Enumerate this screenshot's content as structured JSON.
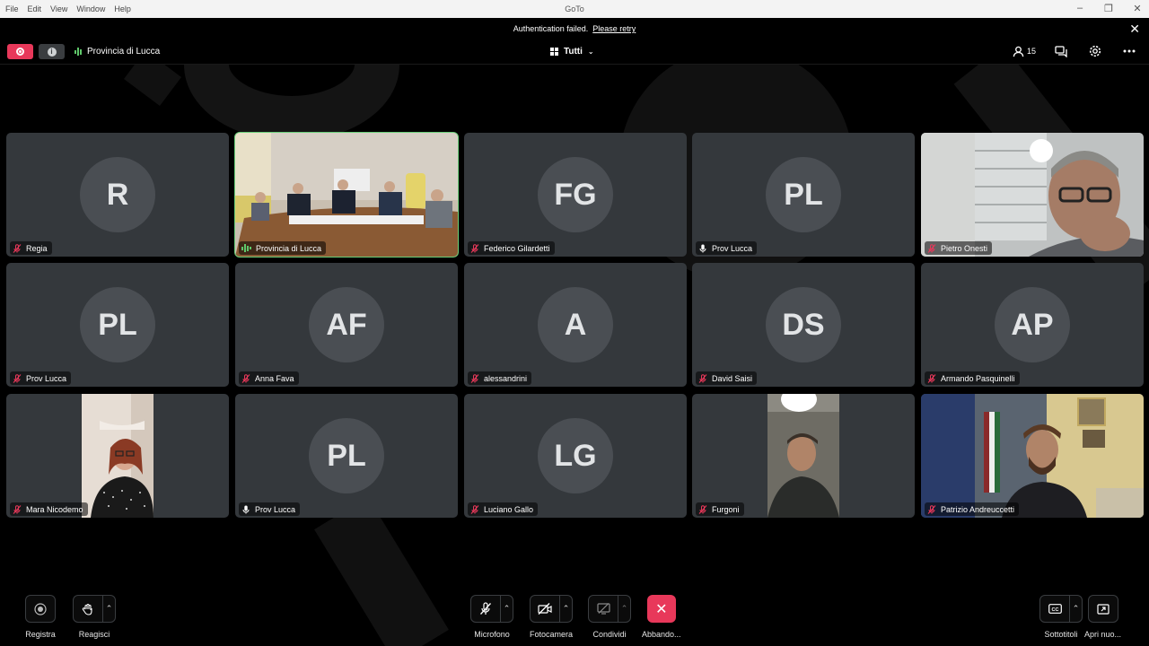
{
  "titlebar": {
    "menu": [
      "File",
      "Edit",
      "View",
      "Window",
      "Help"
    ],
    "app_title": "GoTo"
  },
  "banner": {
    "message": "Authentication failed.",
    "link": "Please retry"
  },
  "toolbar": {
    "meeting_name": "Provincia di Lucca",
    "layout_label": "Tutti",
    "participant_count": "15"
  },
  "tiles": [
    {
      "name": "Regia",
      "initials": "R",
      "mic": "muted"
    },
    {
      "name": "Provincia di Lucca",
      "initials": "",
      "mic": "speaking",
      "video": true
    },
    {
      "name": "Federico Gilardetti",
      "initials": "FG",
      "mic": "muted"
    },
    {
      "name": "Prov Lucca",
      "initials": "PL",
      "mic": "on"
    },
    {
      "name": "Pietro Onesti",
      "initials": "",
      "mic": "muted",
      "video": true
    },
    {
      "name": "Prov Lucca",
      "initials": "PL",
      "mic": "muted"
    },
    {
      "name": "Anna Fava",
      "initials": "AF",
      "mic": "muted"
    },
    {
      "name": "alessandrini",
      "initials": "A",
      "mic": "muted"
    },
    {
      "name": "David Saisi",
      "initials": "DS",
      "mic": "muted"
    },
    {
      "name": "Armando Pasquinelli",
      "initials": "AP",
      "mic": "muted"
    },
    {
      "name": "Mara Nicodemo",
      "initials": "",
      "mic": "muted",
      "video": true
    },
    {
      "name": "Prov Lucca",
      "initials": "PL",
      "mic": "on"
    },
    {
      "name": "Luciano Gallo",
      "initials": "LG",
      "mic": "muted"
    },
    {
      "name": "Furgoni",
      "initials": "",
      "mic": "muted",
      "video": true
    },
    {
      "name": "Patrizio Andreuccetti",
      "initials": "",
      "mic": "muted",
      "video": true
    }
  ],
  "controls": {
    "record": "Registra",
    "react": "Reagisci",
    "microphone": "Microfono",
    "camera": "Fotocamera",
    "share": "Condividi",
    "leave": "Abbando...",
    "captions": "Sottotitoli",
    "open_new": "Apri nuo..."
  },
  "colors": {
    "accent_red": "#e8385a",
    "active_green": "#6ad07a",
    "tile_bg": "#34383c",
    "avatar_bg": "#4a4e53"
  }
}
